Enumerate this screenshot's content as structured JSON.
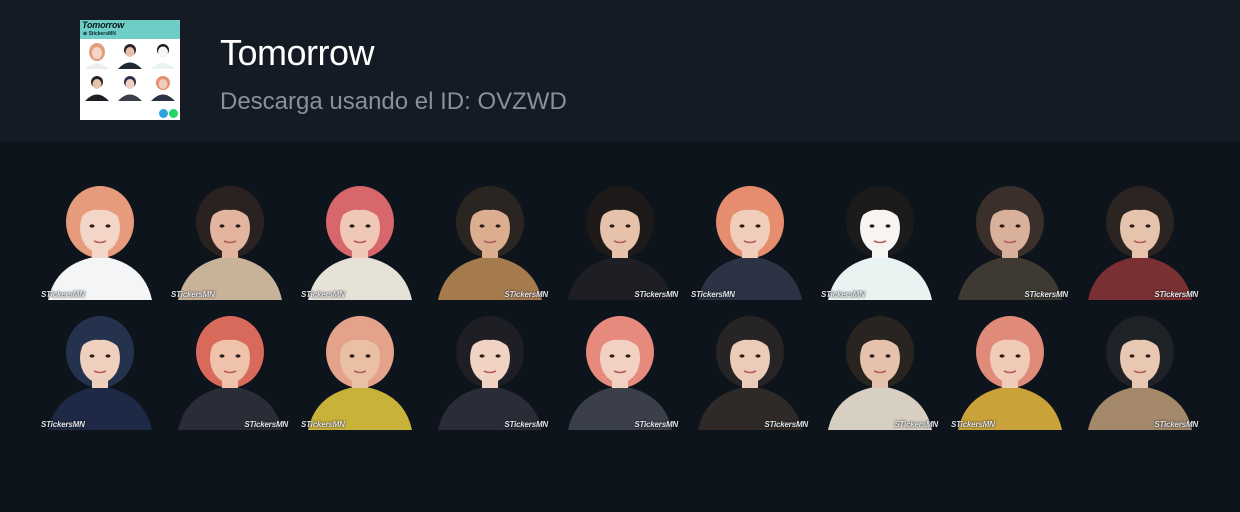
{
  "pack": {
    "title": "Tomorrow",
    "subtitle": "Descarga usando el ID: OVZWD",
    "thumbnail": {
      "title": "Tomorrow",
      "sub": "⊗ StickersMN",
      "telegram_icon": "telegram-icon",
      "whatsapp_icon": "whatsapp-icon"
    }
  },
  "stickers": [
    {
      "watermark": "STickersMN",
      "hair": "#e59b7c",
      "skin": "#f3d6c7",
      "outfit": "#f3f5f7",
      "mark": "left"
    },
    {
      "watermark": "STickersMN",
      "hair": "#2a2220",
      "skin": "#e3b59e",
      "outfit": "#c9b29a",
      "mark": "left"
    },
    {
      "watermark": "STickersMN",
      "hair": "#d8676c",
      "skin": "#f0c8b8",
      "outfit": "#e7e2d8",
      "mark": "left"
    },
    {
      "watermark": "STickersMN",
      "hair": "#2b2521",
      "skin": "#dcae90",
      "outfit": "#a57b4e",
      "mark": "right"
    },
    {
      "watermark": "STickersMN",
      "hair": "#1f1a1a",
      "skin": "#e7c2aa",
      "outfit": "#1e1f24",
      "mark": "right"
    },
    {
      "watermark": "STickersMN",
      "hair": "#e58d6e",
      "skin": "#f1cdbb",
      "outfit": "#2c3344",
      "mark": "left"
    },
    {
      "watermark": "STickersMN",
      "hair": "#1b1b1b",
      "skin": "#f7f4f2",
      "outfit": "#e9f3f1",
      "mark": "left"
    },
    {
      "watermark": "STickersMN",
      "hair": "#3a2f2a",
      "skin": "#d9b09a",
      "outfit": "#3e3a33",
      "mark": "right"
    },
    {
      "watermark": "STickersMN",
      "hair": "#2b2420",
      "skin": "#e6c3ad",
      "outfit": "#7a2f33",
      "mark": "right"
    },
    {
      "watermark": "STickersMN",
      "hair": "#25324d",
      "skin": "#efcfbd",
      "outfit": "#1e2a45",
      "mark": "left"
    },
    {
      "watermark": "STickersMN",
      "hair": "#d86a5c",
      "skin": "#eec2ab",
      "outfit": "#2a2d38",
      "mark": "right"
    },
    {
      "watermark": "STickersMN",
      "hair": "#e5a28a",
      "skin": "#e9c0a4",
      "outfit": "#c9b23a",
      "mark": "left"
    },
    {
      "watermark": "STickersMN",
      "hair": "#1e1f24",
      "skin": "#f0d3c3",
      "outfit": "#2a2d38",
      "mark": "right"
    },
    {
      "watermark": "STickersMN",
      "hair": "#e68a7d",
      "skin": "#f2d1c2",
      "outfit": "#3b3f4a",
      "mark": "right"
    },
    {
      "watermark": "STickersMN",
      "hair": "#262424",
      "skin": "#eccbb9",
      "outfit": "#2f2a27",
      "mark": "right"
    },
    {
      "watermark": "STickersMN",
      "hair": "#2a2420",
      "skin": "#e6c1ab",
      "outfit": "#d8cfc3",
      "mark": "right"
    },
    {
      "watermark": "STickersMN",
      "hair": "#e08a7a",
      "skin": "#efcbb8",
      "outfit": "#c9a23a",
      "mark": "left"
    },
    {
      "watermark": "STickersMN",
      "hair": "#1f2226",
      "skin": "#e9c8b3",
      "outfit": "#a3896a",
      "mark": "right"
    }
  ]
}
